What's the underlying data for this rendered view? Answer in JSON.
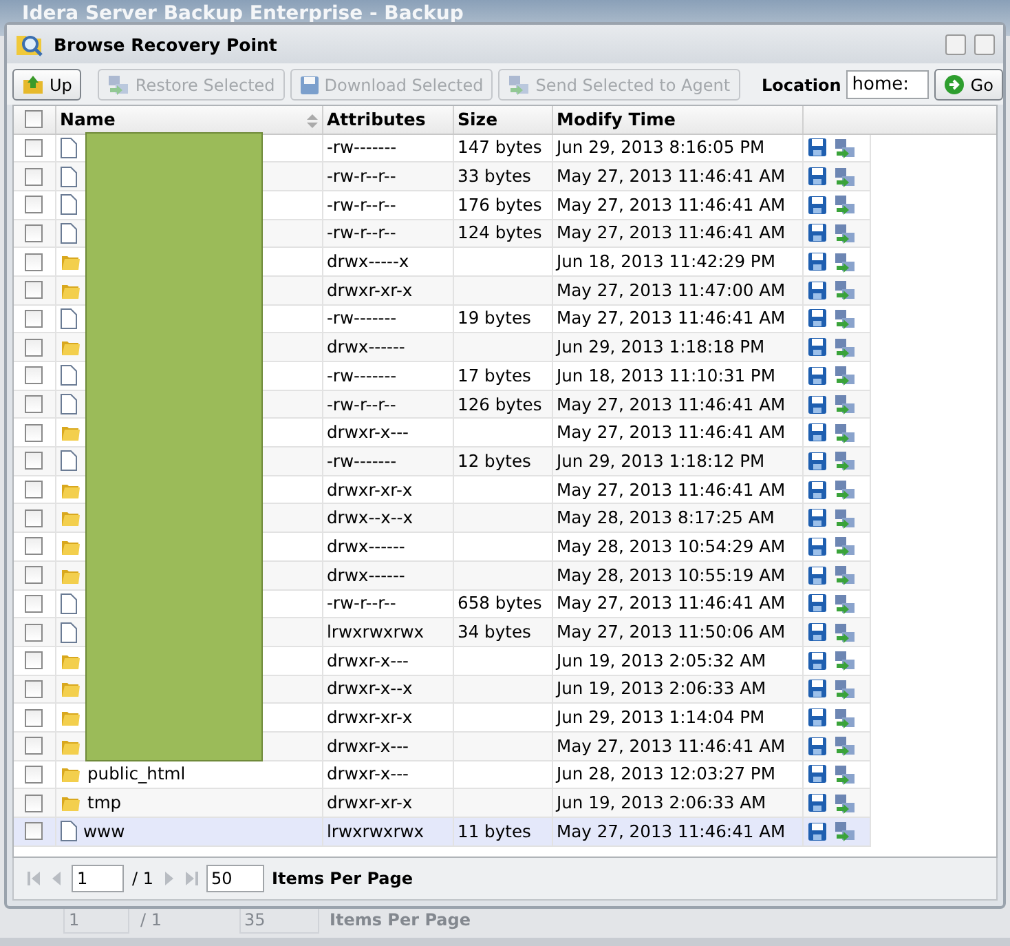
{
  "background": {
    "title": "Idera Server Backup Enterprise - Backup",
    "pager": {
      "page": "1",
      "of": "/ 1",
      "per_page": "35",
      "per_page_label": "Items Per Page"
    }
  },
  "window": {
    "title": "Browse Recovery Point"
  },
  "toolbar": {
    "buttons": [
      {
        "label": "Up",
        "kind": "up",
        "disabled": false
      },
      {
        "label": "Restore Selected",
        "kind": "restore",
        "disabled": true
      },
      {
        "label": "Download Selected",
        "kind": "download",
        "disabled": true
      },
      {
        "label": "Send Selected to Agent",
        "kind": "send",
        "disabled": true
      }
    ],
    "location_label": "Location",
    "location_value": "home:",
    "go": "Go"
  },
  "table": {
    "columns": [
      "Name",
      "Attributes",
      "Size",
      "Modify Time"
    ],
    "redacted": true,
    "select_all_checked": false,
    "rows": [
      {
        "kind": "file",
        "checked": false,
        "attributes": "-rw-------",
        "size": "147 bytes",
        "modified": "Jun 29, 2013 8:16:05 PM",
        "hovered": false
      },
      {
        "kind": "file",
        "checked": false,
        "attributes": "-rw-r--r--",
        "size": "33 bytes",
        "modified": "May 27, 2013 11:46:41 AM",
        "hovered": false
      },
      {
        "kind": "file",
        "checked": false,
        "attributes": "-rw-r--r--",
        "size": "176 bytes",
        "modified": "May 27, 2013 11:46:41 AM",
        "hovered": false
      },
      {
        "kind": "file",
        "checked": false,
        "attributes": "-rw-r--r--",
        "size": "124 bytes",
        "modified": "May 27, 2013 11:46:41 AM",
        "hovered": false
      },
      {
        "kind": "folder",
        "checked": false,
        "attributes": "drwx-----x",
        "modified": "Jun 18, 2013 11:42:29 PM",
        "hovered": false
      },
      {
        "kind": "folder",
        "checked": false,
        "attributes": "drwxr-xr-x",
        "modified": "May 27, 2013 11:47:00 AM",
        "hovered": false
      },
      {
        "kind": "file",
        "checked": false,
        "attributes": "-rw-------",
        "size": "19 bytes",
        "modified": "May 27, 2013 11:46:41 AM",
        "hovered": false
      },
      {
        "kind": "folder",
        "checked": false,
        "attributes": "drwx------",
        "modified": "Jun 29, 2013 1:18:18 PM",
        "hovered": false
      },
      {
        "kind": "file",
        "checked": false,
        "attributes": "-rw-------",
        "size": "17 bytes",
        "modified": "Jun 18, 2013 11:10:31 PM",
        "hovered": false
      },
      {
        "kind": "file",
        "checked": false,
        "attributes": "-rw-r--r--",
        "size": "126 bytes",
        "modified": "May 27, 2013 11:46:41 AM",
        "hovered": false
      },
      {
        "kind": "folder",
        "checked": false,
        "attributes": "drwxr-x---",
        "modified": "May 27, 2013 11:46:41 AM",
        "hovered": false
      },
      {
        "kind": "file",
        "checked": false,
        "attributes": "-rw-------",
        "size": "12 bytes",
        "modified": "Jun 29, 2013 1:18:12 PM",
        "hovered": false
      },
      {
        "kind": "folder",
        "checked": false,
        "attributes": "drwxr-xr-x",
        "modified": "May 27, 2013 11:46:41 AM",
        "hovered": false
      },
      {
        "kind": "folder",
        "checked": false,
        "attributes": "drwx--x--x",
        "modified": "May 28, 2013 8:17:25 AM",
        "hovered": false
      },
      {
        "kind": "folder",
        "checked": false,
        "attributes": "drwx------",
        "modified": "May 28, 2013 10:54:29 AM",
        "hovered": false
      },
      {
        "kind": "folder",
        "checked": false,
        "attributes": "drwx------",
        "modified": "May 28, 2013 10:55:19 AM",
        "hovered": false
      },
      {
        "kind": "file",
        "checked": false,
        "attributes": "-rw-r--r--",
        "size": "658 bytes",
        "modified": "May 27, 2013 11:46:41 AM",
        "hovered": false
      },
      {
        "kind": "file",
        "checked": false,
        "attributes": "lrwxrwxrwx",
        "size": "34 bytes",
        "modified": "May 27, 2013 11:50:06 AM",
        "hovered": false
      },
      {
        "kind": "folder",
        "checked": false,
        "attributes": "drwxr-x---",
        "modified": "Jun 19, 2013 2:05:32 AM",
        "hovered": false
      },
      {
        "kind": "folder",
        "checked": false,
        "attributes": "drwxr-x--x",
        "modified": "Jun 19, 2013 2:06:33 AM",
        "hovered": false
      },
      {
        "kind": "folder",
        "checked": false,
        "attributes": "drwxr-xr-x",
        "modified": "Jun 29, 2013 1:14:04 PM",
        "hovered": false
      },
      {
        "kind": "folder",
        "checked": false,
        "attributes": "drwxr-x---",
        "modified": "May 27, 2013 11:46:41 AM",
        "hovered": false
      },
      {
        "kind": "folder",
        "checked": false,
        "name": "public_html",
        "attributes": "drwxr-x---",
        "modified": "Jun 28, 2013 12:03:27 PM",
        "hovered": false
      },
      {
        "kind": "folder",
        "checked": false,
        "name": "tmp",
        "attributes": "drwxr-xr-x",
        "modified": "Jun 19, 2013 2:06:33 AM",
        "hovered": false
      },
      {
        "kind": "file",
        "checked": false,
        "name": "www",
        "attributes": "lrwxrwxrwx",
        "size": "11 bytes",
        "modified": "May 27, 2013 11:46:41 AM",
        "hovered": true
      }
    ]
  },
  "pager": {
    "page": "1",
    "of": "/ 1",
    "per_page": "50",
    "per_page_label": "Items Per Page"
  }
}
